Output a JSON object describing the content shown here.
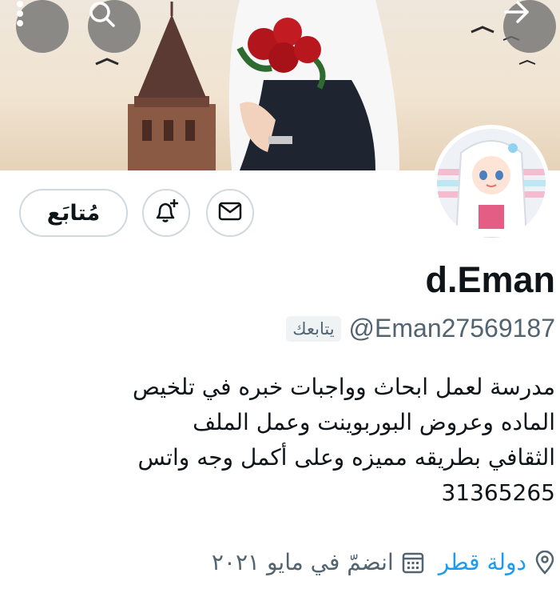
{
  "header": {
    "more_icon": "more-vertical-icon",
    "search_icon": "search-icon",
    "next_icon": "arrow-right-icon"
  },
  "profile": {
    "follow_button_label": "مُتابَع",
    "name": "d.Eman",
    "handle": "@Eman27569187",
    "follows_you_badge": "يتابعك",
    "bio_lines": [
      "مدرسة لعمل ابحاث وواجبات خبره في تلخيص",
      "الماده وعروض البوربوينت  وعمل الملف",
      "الثقافي بطريقه مميزه وعلى أكمل وجه  واتس",
      "31365265"
    ],
    "location": "دولة قطر",
    "joined": "انضمّ في مايو ٢٠٢١"
  },
  "colors": {
    "link": "#1d9bf0",
    "text": "#0f1419",
    "muted": "#536471",
    "border": "#cfd9de"
  }
}
